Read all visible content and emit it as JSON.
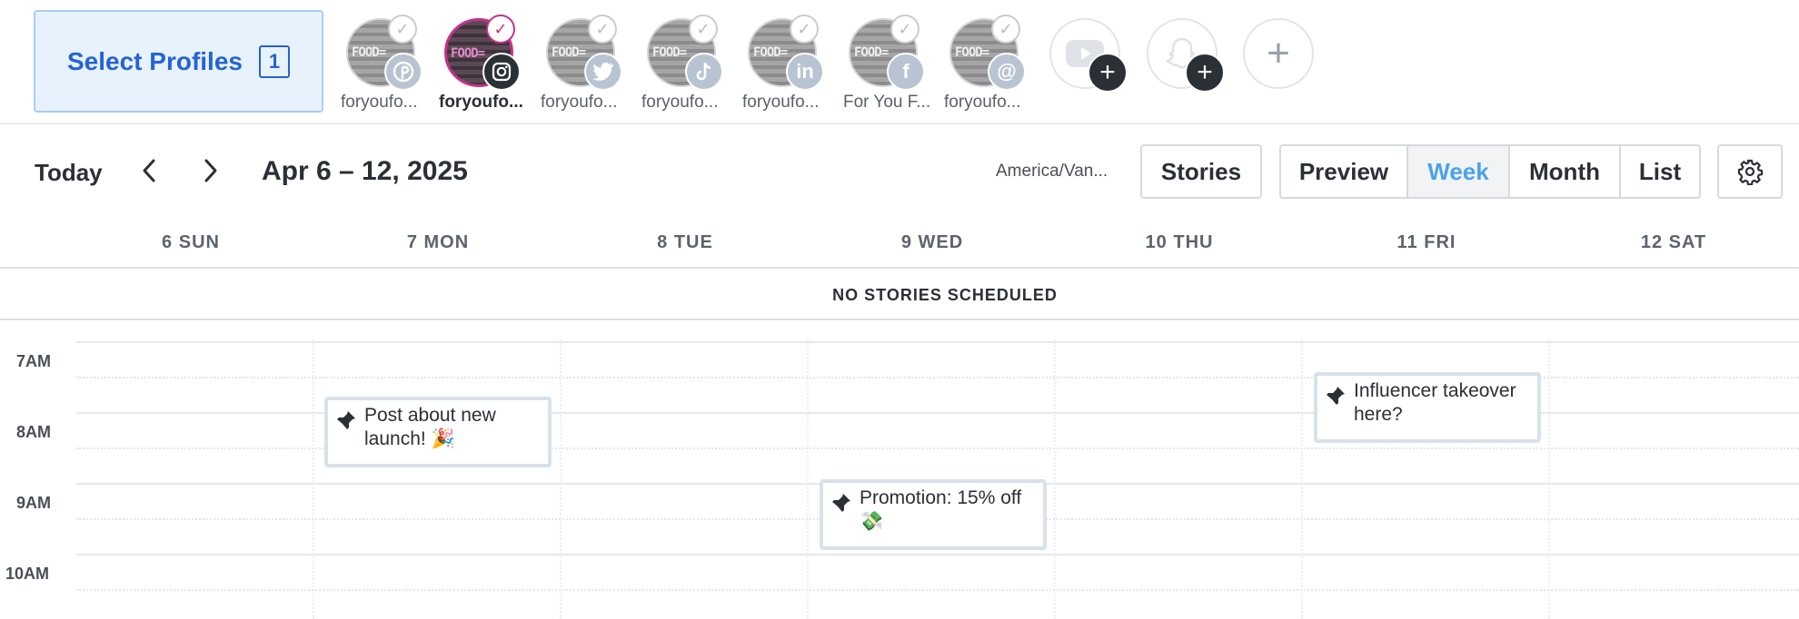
{
  "profile_bar": {
    "select_label": "Select Profiles",
    "selected_count": "1",
    "avatar_text": "FOOD=",
    "profiles": [
      {
        "name": "foryoufo...",
        "network": "pinterest",
        "badge": "P",
        "active": false
      },
      {
        "name": "foryoufo...",
        "network": "instagram",
        "badge": "",
        "active": true
      },
      {
        "name": "foryoufo...",
        "network": "twitter",
        "badge": "",
        "active": false
      },
      {
        "name": "foryoufo...",
        "network": "tiktok",
        "badge": "♪",
        "active": false
      },
      {
        "name": "foryoufo...",
        "network": "linkedin",
        "badge": "in",
        "active": false
      },
      {
        "name": "For You F...",
        "network": "facebook",
        "badge": "f",
        "active": false
      },
      {
        "name": "foryoufo...",
        "network": "threads",
        "badge": "@",
        "active": false
      }
    ],
    "add_profiles": [
      "youtube",
      "snapchat"
    ],
    "add_new_icon": "plus-icon"
  },
  "toolbar": {
    "today": "Today",
    "date_range": "Apr 6 – 12, 2025",
    "timezone": "America/Van...",
    "stories": "Stories",
    "views": [
      "Preview",
      "Week",
      "Month",
      "List"
    ],
    "selected_view": "Week"
  },
  "calendar": {
    "days": [
      "6 SUN",
      "7 MON",
      "8 TUE",
      "9 WED",
      "10 THU",
      "11 FRI",
      "12 SAT"
    ],
    "no_stories": "NO STORIES SCHEDULED",
    "hours": [
      "7AM",
      "8AM",
      "9AM",
      "10AM"
    ],
    "events": [
      {
        "day": "7 MON",
        "time": "8AM",
        "text": "Post about new launch! 🎉"
      },
      {
        "day": "9 WED",
        "time": "9AM",
        "text": "Promotion: 15% off 💸"
      },
      {
        "day": "11 FRI",
        "time": "7AM",
        "text": "Influencer takeover here?"
      }
    ]
  },
  "colors": {
    "accent_blue": "#2463d6",
    "week_selected": "#4aa3e8",
    "instagram_ring": "#c2338a"
  }
}
